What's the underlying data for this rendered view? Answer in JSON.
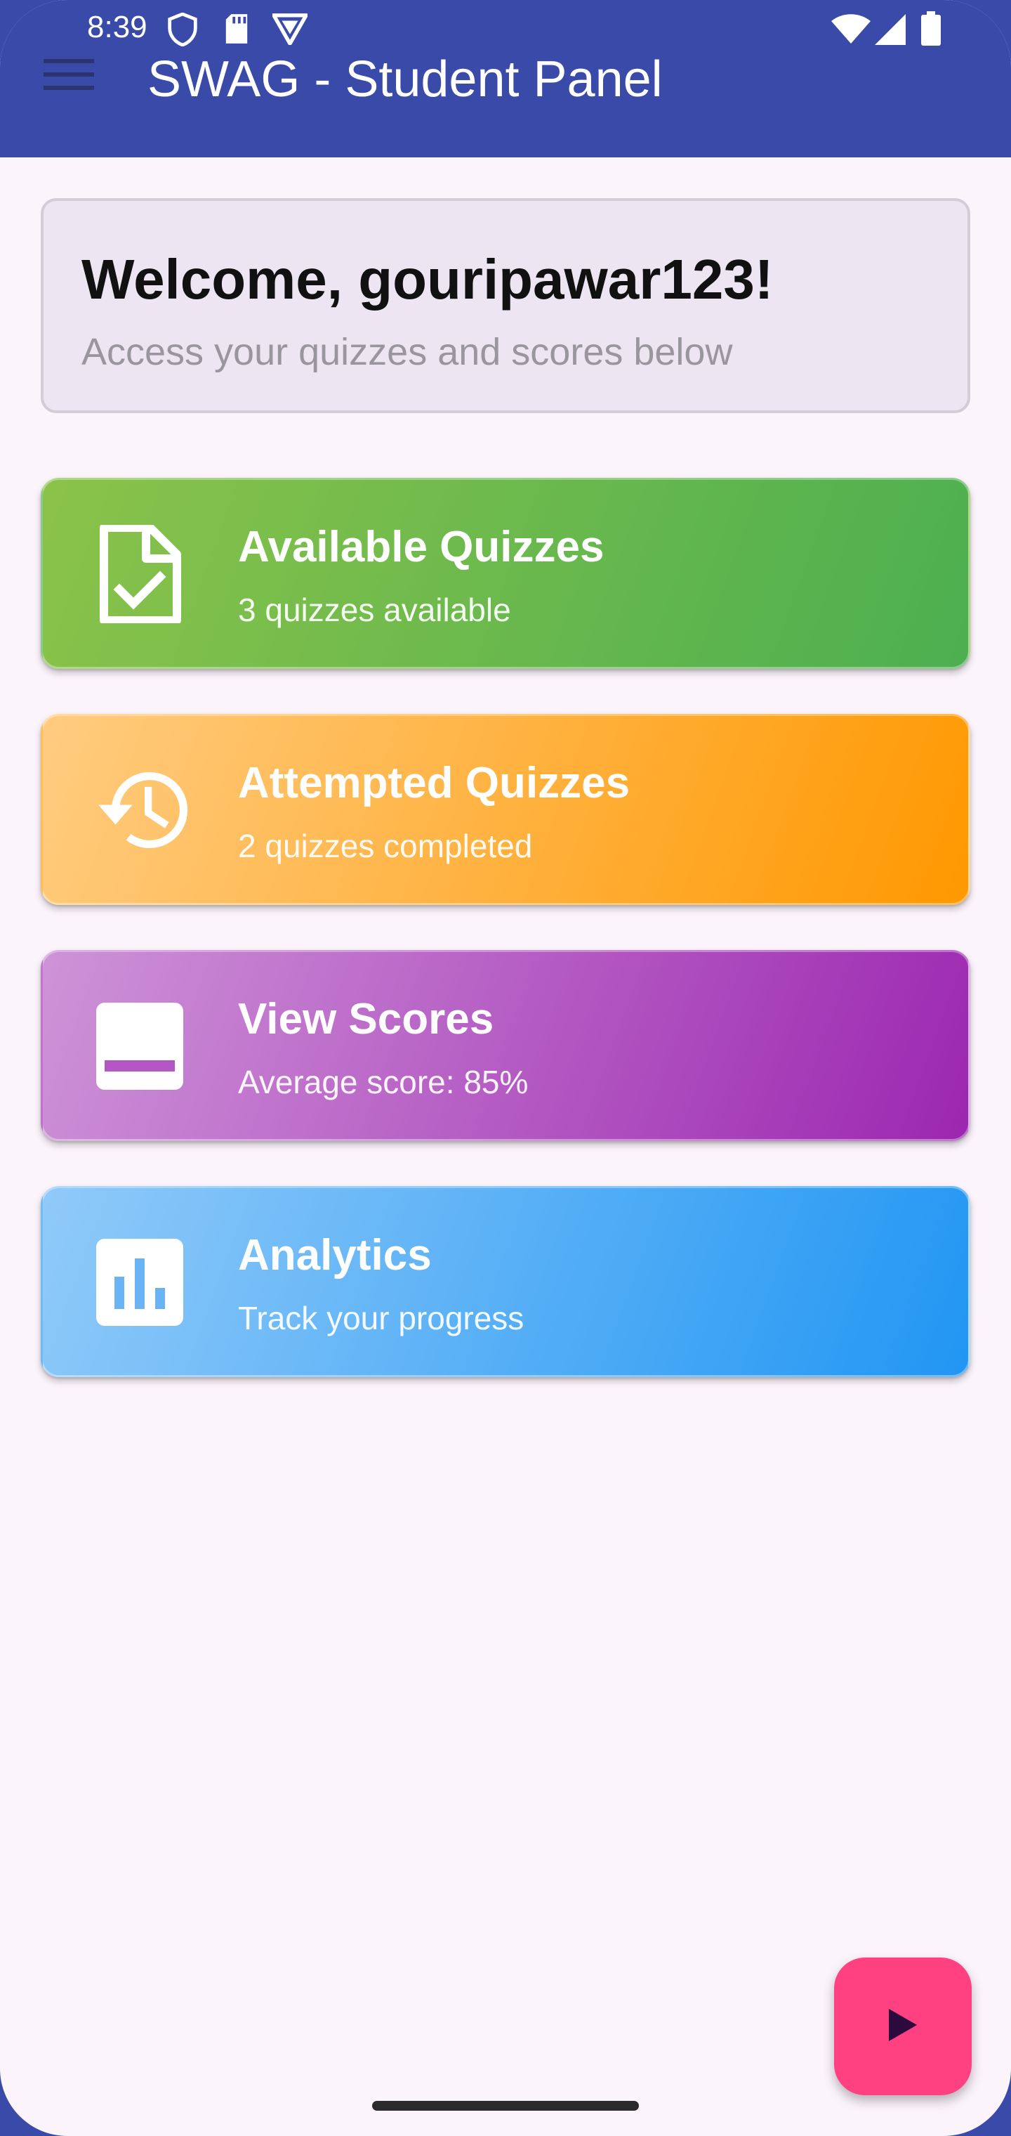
{
  "status_bar": {
    "time": "8:39",
    "left_icons": [
      "shield-icon",
      "sd-card-icon",
      "vpn-badge-icon"
    ],
    "right_icons": [
      "wifi-icon",
      "signal-icon",
      "battery-icon"
    ]
  },
  "app_bar": {
    "title": "SWAG - Student Panel",
    "nav_icon": "hamburger-menu-icon",
    "color": "#3a4aa8"
  },
  "welcome": {
    "title": "Welcome, gouripawar123!",
    "subtitle": "Access your quizzes and scores below"
  },
  "cards": [
    {
      "title": "Available Quizzes",
      "subtitle": "3 quizzes available",
      "icon": "document-check-icon",
      "gradient": [
        "#8bc34a",
        "#4caf50"
      ]
    },
    {
      "title": "Attempted Quizzes",
      "subtitle": "2 quizzes completed",
      "icon": "history-icon",
      "gradient": [
        "#ffcc80",
        "#ff9800"
      ]
    },
    {
      "title": "View Scores",
      "subtitle": "Average score: 85%",
      "icon": "scores-icon",
      "gradient": [
        "#ce93d8",
        "#9c27b0"
      ]
    },
    {
      "title": "Analytics",
      "subtitle": "Track your progress",
      "icon": "bar-chart-icon",
      "gradient": [
        "#90caf9",
        "#2196f3"
      ]
    }
  ],
  "fab": {
    "icon": "play-icon",
    "color": "#ff4081"
  }
}
